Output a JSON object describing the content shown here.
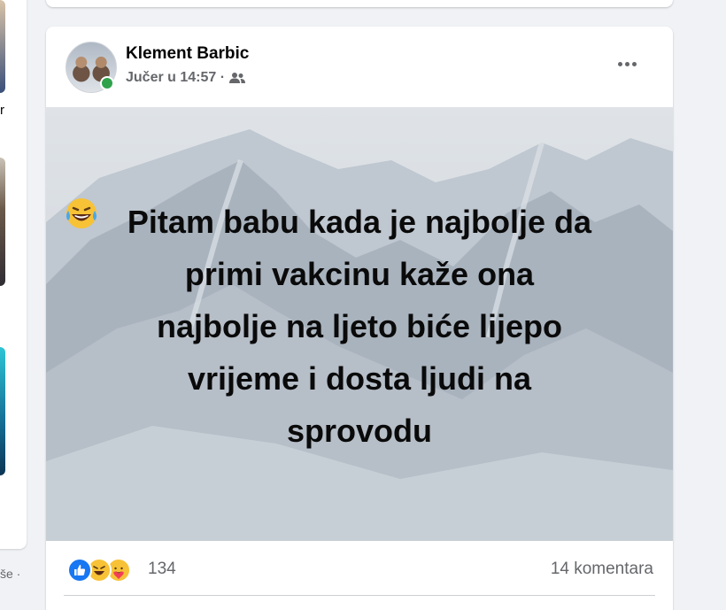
{
  "left_column": {
    "partial_char": "r",
    "footer_text": "še ·"
  },
  "post": {
    "author": "Klement Barbic",
    "timestamp": "Jučer u 14:57 ·",
    "audience_icon": "friends-icon",
    "more_icon": "more-options-icon",
    "text_lines": [
      "Pitam babu kada je najbolje da",
      "primi vakcinu kaže ona",
      "najbolje na ljeto biće lijepo",
      "vrijeme i dosta ljudi na",
      "sprovodu"
    ],
    "text_emoji": "laughing-tears-emoji",
    "reactions": {
      "icons": [
        "like-reaction-icon",
        "haha-reaction-icon",
        "care-reaction-icon"
      ],
      "count": "134"
    },
    "comments_label": "14 komentara"
  },
  "colors": {
    "background": "#f0f2f5",
    "card": "#ffffff",
    "secondary_text": "#65676b",
    "online": "#31a24c",
    "like_blue": "#1877f2"
  }
}
